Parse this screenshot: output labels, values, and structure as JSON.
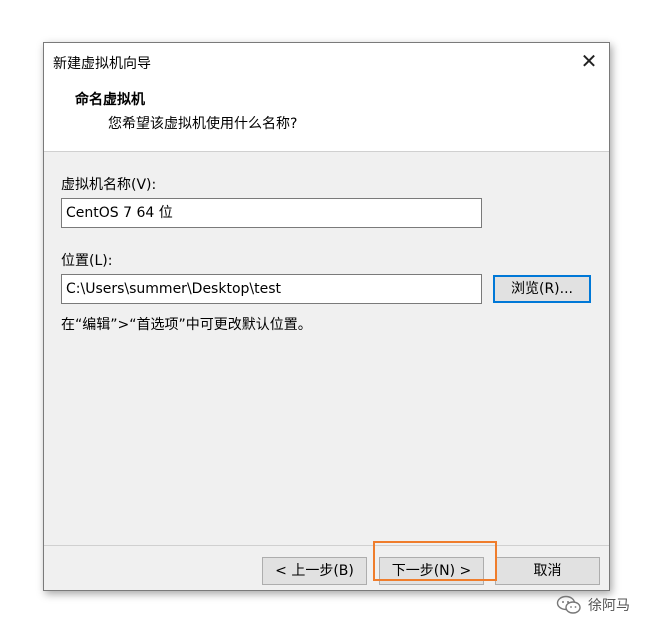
{
  "window": {
    "title": "新建虚拟机向导",
    "close_label": "✕"
  },
  "header": {
    "title": "命名虚拟机",
    "subtitle": "您希望该虚拟机使用什么名称?"
  },
  "form": {
    "name_label": "虚拟机名称(V):",
    "name_value": "CentOS 7 64 位",
    "location_label": "位置(L):",
    "location_value": "C:\\Users\\summer\\Desktop\\test",
    "browse_label": "浏览(R)...",
    "hint": "在“编辑”>“首选项”中可更改默认位置。"
  },
  "footer": {
    "back_label": "< 上一步(B)",
    "next_label": "下一步(N) >",
    "cancel_label": "取消"
  },
  "watermark": {
    "text": "徐阿马",
    "icon": "wechat-icon"
  },
  "colors": {
    "accent": "#0078d7",
    "highlight": "#ef7d2c",
    "dialog_bg": "#f0f0f0"
  }
}
